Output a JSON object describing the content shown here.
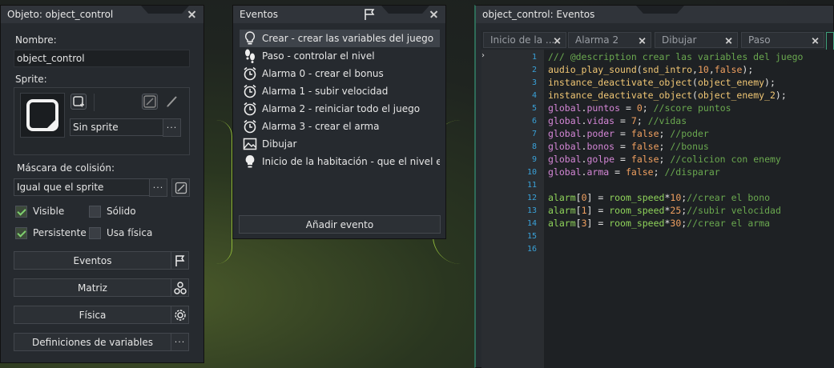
{
  "object_window": {
    "title": "Objeto: object_control",
    "name_label": "Nombre:",
    "name_value": "object_control",
    "sprite_label": "Sprite:",
    "sprite_value": "Sin sprite",
    "mask_label": "Máscara de colisión:",
    "mask_value": "Igual que el sprite",
    "checkboxes": [
      {
        "label": "Visible",
        "checked": true
      },
      {
        "label": "Sólido",
        "checked": false
      },
      {
        "label": "Persistente",
        "checked": true
      },
      {
        "label": "Usa física",
        "checked": false
      }
    ],
    "buttons": {
      "events": "Eventos",
      "matrix": "Matriz",
      "physics": "Física",
      "variables": "Definiciones de variables"
    },
    "dots": "···"
  },
  "events_window": {
    "title": "Eventos",
    "items": [
      {
        "label": "Crear - crear las variables del juego",
        "icon": "lightbulb-icon"
      },
      {
        "label": "Paso - controlar el nivel",
        "icon": "footsteps-icon"
      },
      {
        "label": "Alarma 0 - crear el bonus",
        "icon": "alarm-clock-icon"
      },
      {
        "label": "Alarma 1 - subir velocidad",
        "icon": "alarm-clock-icon"
      },
      {
        "label": "Alarma 2 - reiniciar todo el juego",
        "icon": "alarm-clock-icon"
      },
      {
        "label": "Alarma 3 - crear el arma",
        "icon": "alarm-clock-icon"
      },
      {
        "label": "Dibujar",
        "icon": "picture-icon"
      },
      {
        "label": "Inicio de la habitación - que el nivel emp",
        "icon": "lightbulb-filled-icon"
      }
    ],
    "add_button": "Añadir evento"
  },
  "code_window": {
    "title": "object_control: Eventos",
    "tabs": [
      "Inicio de la ...",
      "Alarma 2",
      "Dibujar",
      "Paso"
    ],
    "line_numbers": [
      "1",
      "2",
      "3",
      "4",
      "5",
      "6",
      "7",
      "8",
      "9",
      "10",
      "11",
      "12",
      "13",
      "14",
      "15",
      "16"
    ],
    "lines": [
      "/// @description crear las variables del juego",
      "audio_play_sound(snd_intro,10,false);",
      "instance_deactivate_object(object_enemy);",
      "instance_deactivate_object(object_enemy_2);",
      "global.puntos = 0; //score puntos",
      "global.vidas = 7; //vidas",
      "global.poder = false; //poder",
      "global.bonos = false; //bonus",
      "global.golpe = false; //colicion con enemy",
      "global.arma = false; //disparar",
      "",
      "alarm[0] = room_speed*10;//crear el bono",
      "alarm[1] = room_speed*25;//subir velocidad",
      "alarm[3] = room_speed*30;//crear el arma",
      "",
      ""
    ]
  }
}
